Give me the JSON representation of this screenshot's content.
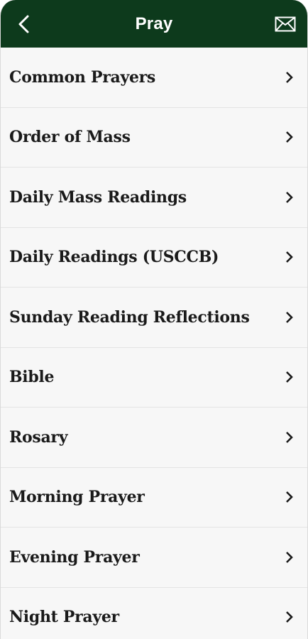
{
  "header": {
    "title": "Pray",
    "back_icon": "chevron-left-icon",
    "mail_icon": "envelope-icon",
    "background": "#0d3a1c"
  },
  "menu": {
    "items": [
      {
        "label": "Common Prayers"
      },
      {
        "label": "Order of Mass"
      },
      {
        "label": "Daily Mass Readings"
      },
      {
        "label": "Daily Readings (USCCB)"
      },
      {
        "label": "Sunday Reading Reflections"
      },
      {
        "label": "Bible"
      },
      {
        "label": "Rosary"
      },
      {
        "label": "Morning Prayer"
      },
      {
        "label": "Evening Prayer"
      },
      {
        "label": "Night Prayer"
      }
    ],
    "chevron_icon": "chevron-right-icon"
  }
}
